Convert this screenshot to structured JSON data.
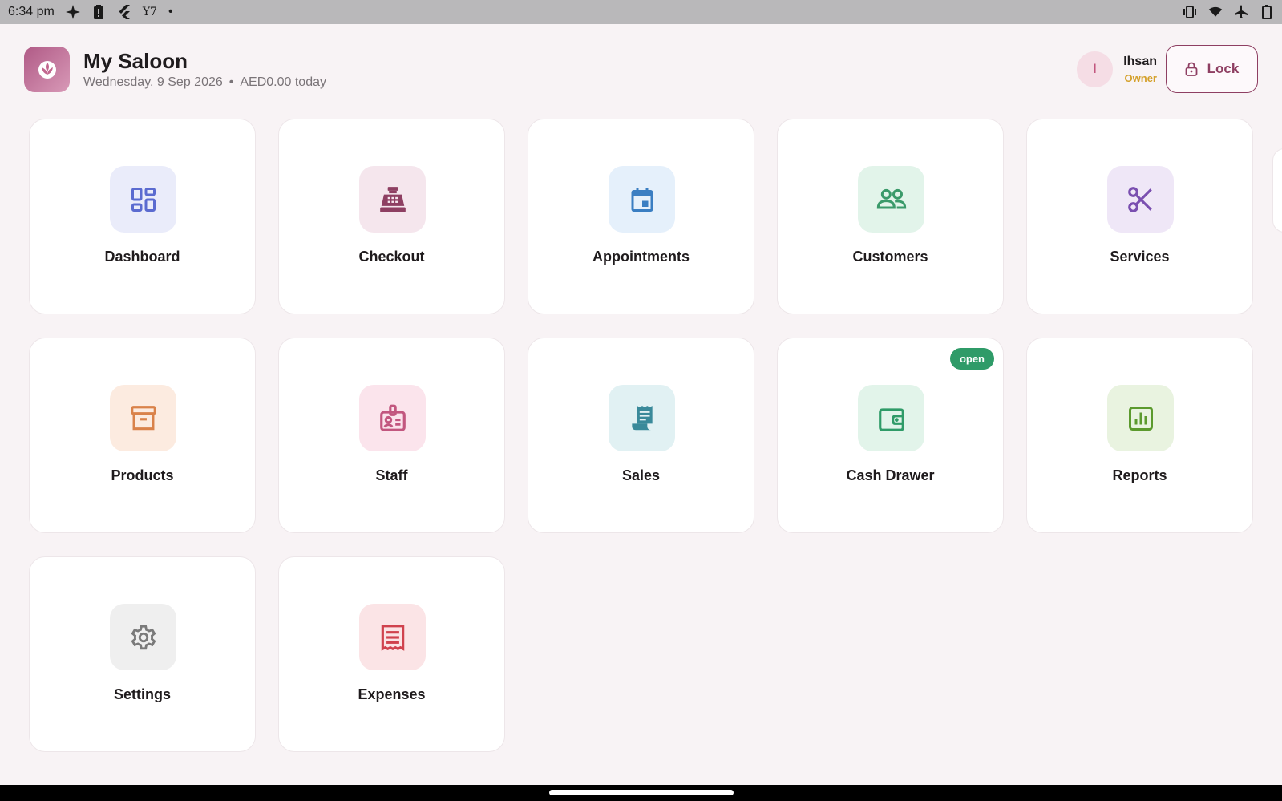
{
  "status_bar": {
    "time": "6:34 pm",
    "yahoo_text": "Y7",
    "dot": "•"
  },
  "header": {
    "title": "My Saloon",
    "date": "Wednesday, 9 Sep 2026",
    "separator": "•",
    "today_total": "AED0.00 today"
  },
  "user": {
    "initial": "I",
    "name": "Ihsan",
    "role": "Owner",
    "lock_label": "Lock"
  },
  "tiles": [
    {
      "label": "Dashboard",
      "icon": "dashboard-icon",
      "color": "#5b6bd0",
      "bg": "#eaecfa"
    },
    {
      "label": "Checkout",
      "icon": "cash-register-icon",
      "color": "#8e3f62",
      "bg": "#f5e6ed"
    },
    {
      "label": "Appointments",
      "icon": "calendar-icon",
      "color": "#3a7ec2",
      "bg": "#e5f0fb"
    },
    {
      "label": "Customers",
      "icon": "people-icon",
      "color": "#3a9a6a",
      "bg": "#e2f4ea"
    },
    {
      "label": "Services",
      "icon": "scissors-icon",
      "color": "#7a4fb0",
      "bg": "#efe7f7"
    },
    {
      "label": "Products",
      "icon": "archive-box-icon",
      "color": "#d9824a",
      "bg": "#fcebe0"
    },
    {
      "label": "Staff",
      "icon": "id-badge-icon",
      "color": "#c2577f",
      "bg": "#fbe4ec"
    },
    {
      "label": "Sales",
      "icon": "receipt-icon",
      "color": "#3a8a9a",
      "bg": "#e1f1f3"
    },
    {
      "label": "Cash Drawer",
      "icon": "wallet-icon",
      "color": "#2f9b68",
      "bg": "#e2f4ea",
      "badge": "open"
    },
    {
      "label": "Reports",
      "icon": "bar-chart-icon",
      "color": "#5c9a2e",
      "bg": "#e9f3e0"
    },
    {
      "label": "Settings",
      "icon": "gear-icon",
      "color": "#7a7a7a",
      "bg": "#efefef"
    },
    {
      "label": "Expenses",
      "icon": "bill-icon",
      "color": "#d0424e",
      "bg": "#fbe4e6"
    }
  ]
}
